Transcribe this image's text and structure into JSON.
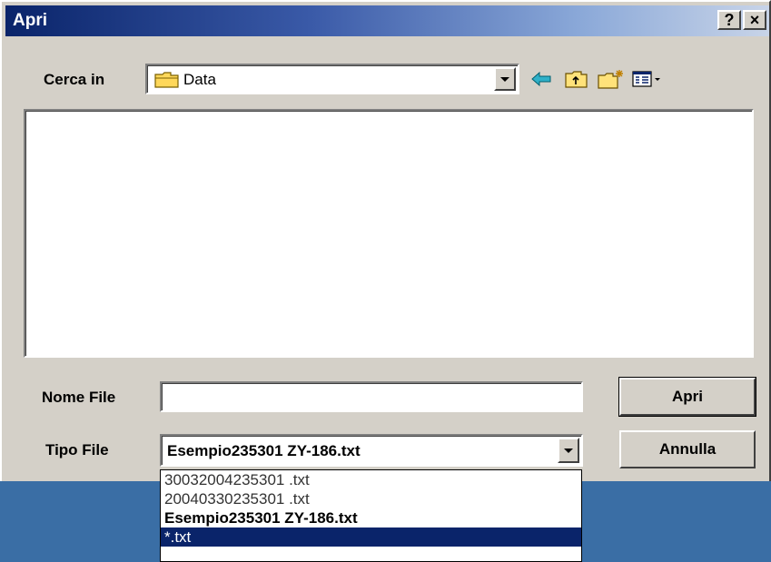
{
  "window": {
    "title": "Apri",
    "help_label": "?",
    "close_label": "×"
  },
  "lookin": {
    "label": "Cerca in",
    "value": "Data"
  },
  "toolbar": {
    "icons": [
      "back-arrow-icon",
      "up-folder-icon",
      "new-folder-icon",
      "view-menu-icon"
    ]
  },
  "filename": {
    "label": "Nome File",
    "value": ""
  },
  "filetype": {
    "label": "Tipo File",
    "value": "Esempio235301 ZY-186.txt",
    "options": [
      "30032004235301 .txt",
      "20040330235301 .txt",
      "Esempio235301 ZY-186.txt",
      "*.txt"
    ],
    "selected_option": "*.txt"
  },
  "buttons": {
    "open": "Apri",
    "cancel": "Annulla"
  },
  "colors": {
    "title_start": "#0a246a",
    "title_end": "#c8d4e8",
    "dialog_bg": "#d4d0c8",
    "selection": "#0a246a",
    "desktop": "#3a6ea5"
  }
}
